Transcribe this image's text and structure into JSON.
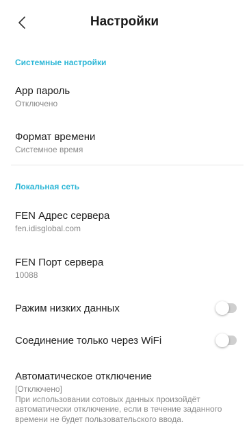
{
  "header": {
    "title": "Настройки",
    "back_icon": "chevron-left-icon"
  },
  "system": {
    "section_title": "Системные настройки",
    "app_password": {
      "label": "App пароль",
      "value": "Отключено"
    },
    "time_format": {
      "label": "Формат времени",
      "value": "Системное время"
    }
  },
  "network": {
    "section_title": "Локальная сеть",
    "server_address": {
      "label": "FEN Адрес сервера",
      "value": "fen.idisglobal.com"
    },
    "server_port": {
      "label": "FEN Порт сервера",
      "value": "10088"
    },
    "low_data_mode": {
      "label": "Ражим низких данных",
      "enabled": false
    },
    "wifi_only": {
      "label": "Соединение только через WiFi",
      "enabled": false
    },
    "auto_off": {
      "label": "Автоматическое отключение",
      "value": "[Отключено]",
      "description": "При использовании сотовых данных произойдёт автоматически отключение, если в течение заданного времени не будет пользовательского ввода."
    }
  },
  "colors": {
    "accent": "#2bb6d6",
    "toggle_off": "#cfcfcf",
    "text_secondary": "#8a8a8a"
  }
}
